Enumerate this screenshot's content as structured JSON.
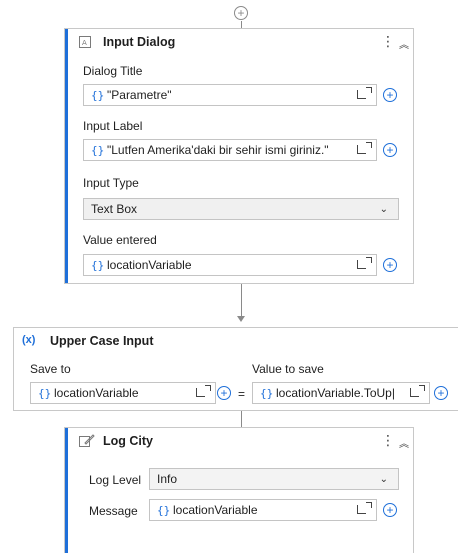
{
  "input_dialog": {
    "title": "Input Dialog",
    "dialog_title_label": "Dialog Title",
    "dialog_title_value": "\"Parametre\"",
    "input_label_label": "Input Label",
    "input_label_value": "\"Lutfen Amerika'daki bir sehir ismi giriniz.\"",
    "input_type_label": "Input Type",
    "input_type_value": "Text Box",
    "value_entered_label": "Value entered",
    "value_entered_value": "locationVariable"
  },
  "assign": {
    "title_prefix": "(x)",
    "title": "Upper Case Input",
    "save_to_label": "Save to",
    "save_to_value": "locationVariable",
    "equals": "=",
    "value_to_save_label": "Value to save",
    "value_to_save_value": "locationVariable.ToUp|"
  },
  "log": {
    "title": "Log City",
    "log_level_label": "Log Level",
    "log_level_value": "Info",
    "message_label": "Message",
    "message_value": "locationVariable"
  },
  "icons": {
    "braces": "{}",
    "plus": "+",
    "dots": "⋮",
    "collapse": "︽",
    "chevron": "⌄"
  },
  "colors": {
    "accent": "#1e6fd9",
    "border": "#c8c8c8",
    "connector": "#8a8a8a"
  }
}
